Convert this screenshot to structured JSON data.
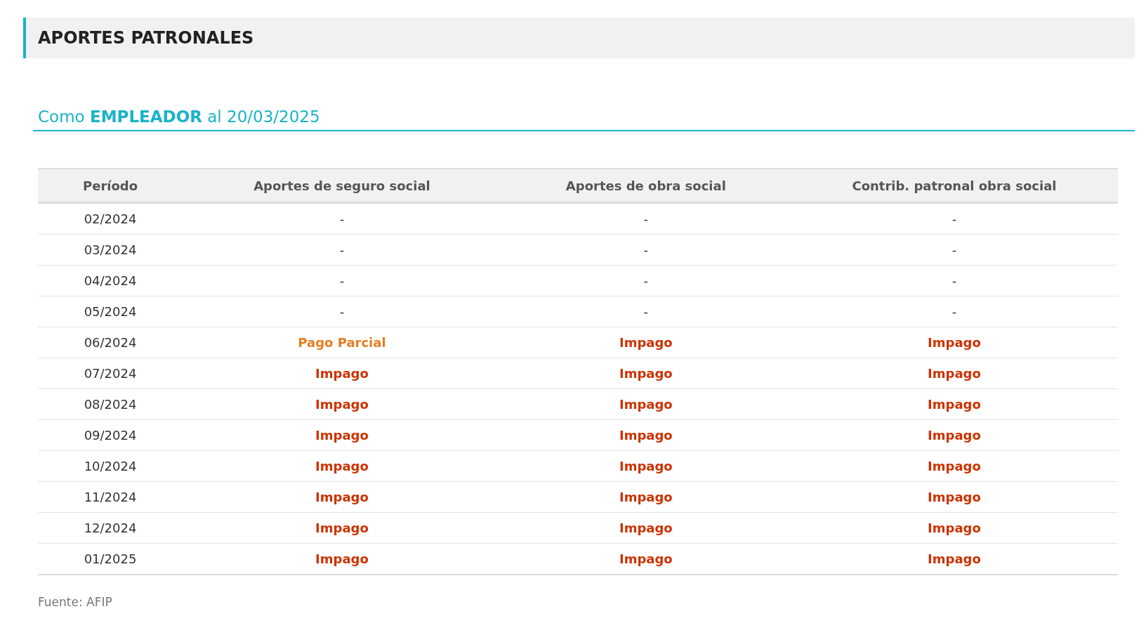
{
  "section_title": "APORTES PATRONALES",
  "subtitle": "Como **EMPLEADOR** al 20/03/2025",
  "table": {
    "columns": [
      "Período",
      "Aportes de seguro social",
      "Aportes de obra social",
      "Contrib. patronal obra social"
    ],
    "rows": [
      [
        {
          "text": "02/2024",
          "kind": "plain"
        },
        {
          "text": "-",
          "kind": "plain"
        },
        {
          "text": "-",
          "kind": "plain"
        },
        {
          "text": "-",
          "kind": "plain"
        }
      ],
      [
        {
          "text": "03/2024",
          "kind": "plain"
        },
        {
          "text": "-",
          "kind": "plain"
        },
        {
          "text": "-",
          "kind": "plain"
        },
        {
          "text": "-",
          "kind": "plain"
        }
      ],
      [
        {
          "text": "04/2024",
          "kind": "plain"
        },
        {
          "text": "-",
          "kind": "plain"
        },
        {
          "text": "-",
          "kind": "plain"
        },
        {
          "text": "-",
          "kind": "plain"
        }
      ],
      [
        {
          "text": "05/2024",
          "kind": "plain"
        },
        {
          "text": "-",
          "kind": "plain"
        },
        {
          "text": "-",
          "kind": "plain"
        },
        {
          "text": "-",
          "kind": "plain"
        }
      ],
      [
        {
          "text": "06/2024",
          "kind": "plain"
        },
        {
          "text": "Pago Parcial",
          "kind": "partial"
        },
        {
          "text": "Impago",
          "kind": "unpaid"
        },
        {
          "text": "Impago",
          "kind": "unpaid"
        }
      ],
      [
        {
          "text": "07/2024",
          "kind": "plain"
        },
        {
          "text": "Impago",
          "kind": "unpaid"
        },
        {
          "text": "Impago",
          "kind": "unpaid"
        },
        {
          "text": "Impago",
          "kind": "unpaid"
        }
      ],
      [
        {
          "text": "08/2024",
          "kind": "plain"
        },
        {
          "text": "Impago",
          "kind": "unpaid"
        },
        {
          "text": "Impago",
          "kind": "unpaid"
        },
        {
          "text": "Impago",
          "kind": "unpaid"
        }
      ],
      [
        {
          "text": "09/2024",
          "kind": "plain"
        },
        {
          "text": "Impago",
          "kind": "unpaid"
        },
        {
          "text": "Impago",
          "kind": "unpaid"
        },
        {
          "text": "Impago",
          "kind": "unpaid"
        }
      ],
      [
        {
          "text": "10/2024",
          "kind": "plain"
        },
        {
          "text": "Impago",
          "kind": "unpaid"
        },
        {
          "text": "Impago",
          "kind": "unpaid"
        },
        {
          "text": "Impago",
          "kind": "unpaid"
        }
      ],
      [
        {
          "text": "11/2024",
          "kind": "plain"
        },
        {
          "text": "Impago",
          "kind": "unpaid"
        },
        {
          "text": "Impago",
          "kind": "unpaid"
        },
        {
          "text": "Impago",
          "kind": "unpaid"
        }
      ],
      [
        {
          "text": "12/2024",
          "kind": "plain"
        },
        {
          "text": "Impago",
          "kind": "unpaid"
        },
        {
          "text": "Impago",
          "kind": "unpaid"
        },
        {
          "text": "Impago",
          "kind": "unpaid"
        }
      ],
      [
        {
          "text": "01/2025",
          "kind": "plain"
        },
        {
          "text": "Impago",
          "kind": "unpaid"
        },
        {
          "text": "Impago",
          "kind": "unpaid"
        },
        {
          "text": "Impago",
          "kind": "unpaid"
        }
      ]
    ]
  },
  "source": "Fuente: AFIP"
}
